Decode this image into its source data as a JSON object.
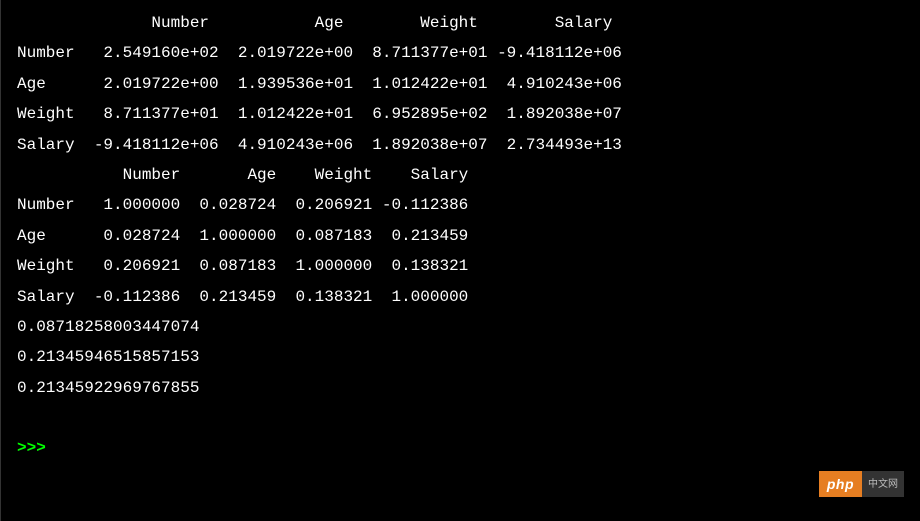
{
  "table1": {
    "header": "              Number           Age        Weight        Salary",
    "rows": [
      "Number   2.549160e+02  2.019722e+00  8.711377e+01 -9.418112e+06",
      "Age      2.019722e+00  1.939536e+01  1.012422e+01  4.910243e+06",
      "Weight   8.711377e+01  1.012422e+01  6.952895e+02  1.892038e+07",
      "Salary  -9.418112e+06  4.910243e+06  1.892038e+07  2.734493e+13"
    ]
  },
  "table2": {
    "header": "           Number       Age    Weight    Salary",
    "rows": [
      "Number   1.000000  0.028724  0.206921 -0.112386",
      "Age      0.028724  1.000000  0.087183  0.213459",
      "Weight   0.206921  0.087183  1.000000  0.138321",
      "Salary  -0.112386  0.213459  0.138321  1.000000"
    ]
  },
  "scalars": [
    "0.08718258003447074",
    "0.21345946515857153",
    "0.21345922969767855"
  ],
  "prompt": ">>> ",
  "badge": {
    "left": "php",
    "right": "中文网"
  }
}
